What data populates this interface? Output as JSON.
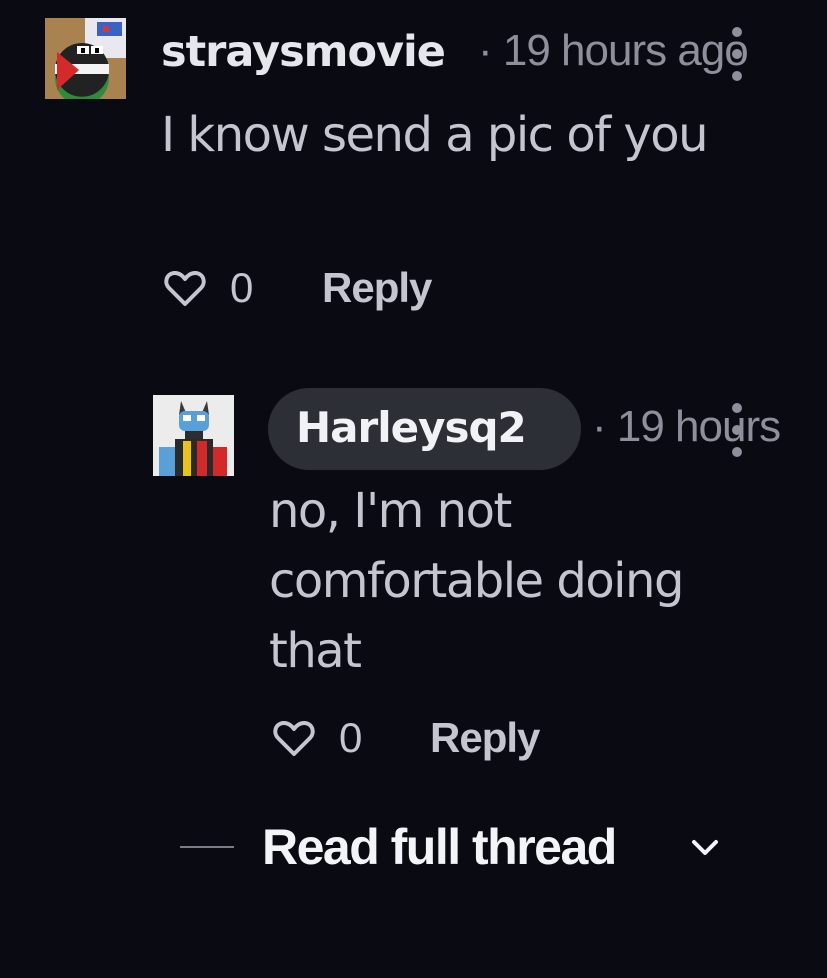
{
  "comments": [
    {
      "username": "straysmovie",
      "meta": "· 19 hours ago",
      "body": "I know send a pic of you",
      "like_count": "0",
      "reply_label": "Reply",
      "avatar_icon": "countryball-flag-avatar",
      "colors": {
        "avatar_bg": "#a9834f"
      }
    },
    {
      "username": "Harleysq2",
      "meta": "· 19 hours",
      "body": "no, I'm not comfortable doing that",
      "like_count": "0",
      "reply_label": "Reply",
      "avatar_icon": "robot-character-avatar",
      "highlighted_author": true
    }
  ],
  "thread_link": {
    "label": "Read full thread",
    "icon": "chevron-down-icon"
  },
  "colors": {
    "background": "#0a0a12",
    "username": "#e6e7ed",
    "meta": "#8d8f9a",
    "body_text": "#c4c6cf",
    "author_pill": "#2d2f36"
  }
}
